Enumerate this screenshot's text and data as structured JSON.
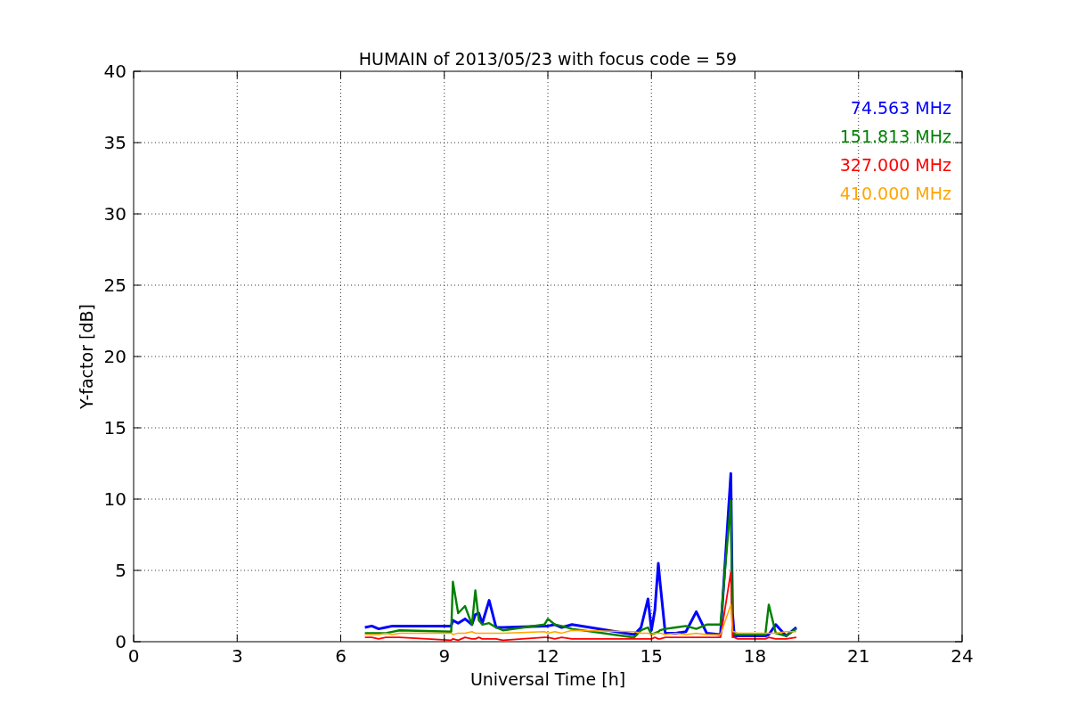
{
  "chart_data": {
    "type": "line",
    "grid": true,
    "title": "HUMAIN of 2013/05/23 with focus code = 59",
    "xlabel": "Universal Time [h]",
    "ylabel": "Y-factor [dB]",
    "xlim": [
      0,
      24
    ],
    "ylim": [
      0,
      40
    ],
    "xticks": [
      0,
      3,
      6,
      9,
      12,
      15,
      18,
      21,
      24
    ],
    "yticks": [
      0,
      5,
      10,
      15,
      20,
      25,
      30,
      35,
      40
    ],
    "x": [
      6.7,
      6.9,
      7.1,
      7.3,
      7.5,
      7.7,
      9.2,
      9.25,
      9.4,
      9.6,
      9.8,
      9.9,
      10.0,
      10.1,
      10.3,
      10.5,
      10.7,
      11.9,
      12.0,
      12.2,
      12.4,
      12.7,
      14.5,
      14.7,
      14.9,
      15.0,
      15.1,
      15.2,
      15.25,
      15.4,
      15.7,
      16.0,
      16.3,
      16.6,
      17.0,
      17.3,
      17.35,
      17.4,
      17.5,
      18.3,
      18.4,
      18.6,
      18.9,
      19.2
    ],
    "series": [
      {
        "name": "74.563 MHz",
        "color": "#0000ff",
        "values": [
          1.0,
          1.1,
          0.9,
          1.0,
          1.1,
          1.1,
          1.1,
          1.5,
          1.3,
          1.6,
          1.2,
          1.9,
          2.0,
          1.3,
          2.9,
          1.0,
          1.0,
          1.1,
          1.1,
          1.2,
          1.0,
          1.2,
          0.5,
          1.0,
          3.0,
          0.8,
          2.2,
          5.5,
          4.2,
          0.6,
          0.6,
          0.7,
          2.1,
          0.6,
          0.5,
          11.8,
          2.0,
          0.4,
          0.4,
          0.4,
          0.5,
          1.2,
          0.4,
          1.0
        ]
      },
      {
        "name": "151.813 MHz",
        "color": "#008000",
        "values": [
          0.6,
          0.6,
          0.6,
          0.6,
          0.7,
          0.8,
          0.7,
          4.2,
          2.0,
          2.5,
          1.2,
          3.6,
          1.5,
          1.2,
          1.3,
          1.0,
          0.8,
          1.2,
          1.6,
          1.2,
          1.1,
          0.9,
          0.3,
          0.8,
          1.0,
          0.5,
          0.6,
          0.7,
          0.8,
          0.9,
          1.0,
          1.1,
          0.9,
          1.2,
          1.2,
          9.9,
          0.8,
          0.5,
          0.5,
          0.5,
          2.6,
          0.6,
          0.4,
          0.9
        ]
      },
      {
        "name": "327.000 MHz",
        "color": "#ff0000",
        "values": [
          0.3,
          0.3,
          0.2,
          0.3,
          0.3,
          0.3,
          0.1,
          0.2,
          0.1,
          0.3,
          0.2,
          0.2,
          0.3,
          0.2,
          0.2,
          0.2,
          0.1,
          0.3,
          0.3,
          0.2,
          0.3,
          0.2,
          0.2,
          0.2,
          0.2,
          0.2,
          0.3,
          0.2,
          0.2,
          0.3,
          0.3,
          0.3,
          0.3,
          0.3,
          0.3,
          4.9,
          0.3,
          0.3,
          0.2,
          0.2,
          0.3,
          0.2,
          0.2,
          0.3
        ]
      },
      {
        "name": "410.000 MHz",
        "color": "#ffa500",
        "values": [
          0.5,
          0.5,
          0.5,
          0.6,
          0.5,
          0.6,
          0.6,
          0.5,
          0.6,
          0.6,
          0.7,
          0.6,
          0.6,
          0.6,
          0.6,
          0.6,
          0.6,
          0.7,
          0.6,
          0.7,
          0.6,
          0.8,
          0.7,
          0.6,
          0.6,
          0.5,
          0.6,
          0.6,
          0.6,
          0.5,
          0.6,
          0.5,
          0.6,
          0.5,
          0.5,
          2.6,
          0.7,
          0.7,
          0.6,
          0.6,
          0.6,
          0.6,
          0.7,
          0.7
        ]
      }
    ]
  }
}
